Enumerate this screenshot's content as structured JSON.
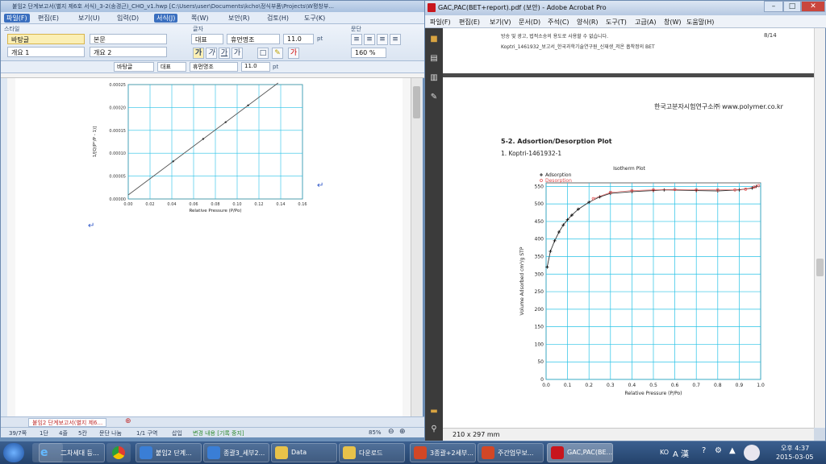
{
  "left": {
    "title": "붙임2 단계보고서(별지 제6호 서식)_3-2(송경근)_CHO_v1.hwp [C:\\Users\\user\\Documents\\kcho\\정식부품\\Projects\\W평창부...",
    "menu": [
      "파일(F)",
      "편집(E)",
      "보기(U)",
      "입력(D)",
      "서식(J)",
      "쪽(W)",
      "보안(R)",
      "검토(H)",
      "도구(K)"
    ],
    "ribbon": {
      "style_label": "스타일",
      "styles": [
        "바탕글",
        "개요 1",
        "본문",
        "개요 2"
      ],
      "font_label": "글자",
      "font_lang": "대표",
      "font_name": "휴먼명조",
      "font_size": "11.0",
      "font_unit": "pt",
      "para_label": "문단",
      "zoom_line": "160 %"
    },
    "toolbar2": {
      "style": "바탕글",
      "lang": "대표",
      "font": "휴먼명조",
      "size": "11.0",
      "unit": "pt"
    },
    "doc_tab": "붙임2 단계보고서(별지 제6...",
    "status": [
      "39/7쪽",
      "1단",
      "4줄",
      "5칸",
      "문단 나눔",
      "1/1 구역",
      "삽입",
      "변경 내용 [기록 중지]"
    ],
    "zoom": "85%",
    "graph": {
      "ylabel": "1/[Q(P°/P - 1)]",
      "xlabel": "Relative Pressure (P/Po)",
      "yticks": [
        "0.00025",
        "0.00020",
        "0.00015",
        "0.00010",
        "0.00005",
        "0.00000"
      ],
      "xticks": [
        "0.00",
        "0.02",
        "0.04",
        "0.06",
        "0.08",
        "0.10",
        "0.12",
        "0.14",
        "0.16"
      ]
    },
    "colors": {
      "grid": "#27c2e6",
      "line": "#555555"
    }
  },
  "right": {
    "title": "GAC,PAC(BET+report).pdf (보안) - Adobe Acrobat Pro",
    "menu": [
      "파일(F)",
      "편집(E)",
      "보기(V)",
      "문서(D)",
      "주석(C)",
      "양식(R)",
      "도구(T)",
      "고급(A)",
      "창(W)",
      "도움말(H)"
    ],
    "page_top_line1": "방송 및 광고, 법적소송의 용도로 사용할 수 없습니다.",
    "page_top_line2": "Koptri_1461932_보고서_한국과학기술연구원_신재생_저온 흡착정의 BET",
    "page_number": "8/14",
    "org_header": "한국고분자시험연구소㈜ www.polymer.co.kr",
    "section_title": "5-2. Adsortion/Desorption Plot",
    "sample_id": "1. Koptri-1461932-1",
    "page_size": "210 x 297 mm",
    "chart_data": {
      "type": "scatter",
      "title": "Isotherm Plot",
      "xlabel": "Relative Pressure (P/Po)",
      "ylabel": "Volume Adsorbed cm³/g STP",
      "xlim": [
        0,
        1.0
      ],
      "ylim": [
        0,
        560
      ],
      "xticks": [
        0,
        0.1,
        0.2,
        0.3,
        0.4,
        0.5,
        0.6,
        0.7,
        0.8,
        0.9,
        1.0
      ],
      "yticks": [
        0,
        50,
        100,
        150,
        200,
        250,
        300,
        350,
        400,
        450,
        500,
        550
      ],
      "grid": true,
      "legend": "top-left",
      "series": [
        {
          "name": "Adsorption",
          "marker": "+",
          "color": "#000000",
          "x": [
            0.005,
            0.02,
            0.04,
            0.06,
            0.08,
            0.1,
            0.12,
            0.15,
            0.2,
            0.25,
            0.3,
            0.4,
            0.5,
            0.55,
            0.7,
            0.8,
            0.9,
            0.96,
            0.98
          ],
          "y": [
            320,
            365,
            395,
            420,
            440,
            455,
            468,
            485,
            505,
            520,
            530,
            535,
            538,
            540,
            538,
            537,
            540,
            545,
            550
          ]
        },
        {
          "name": "Desorption",
          "marker": "o",
          "color": "#e05050",
          "x": [
            0.99,
            0.97,
            0.93,
            0.88,
            0.8,
            0.7,
            0.6,
            0.5,
            0.4,
            0.3,
            0.22
          ],
          "y": [
            552,
            548,
            542,
            540,
            540,
            540,
            541,
            540,
            538,
            533,
            515
          ]
        }
      ]
    }
  },
  "taskbar": {
    "tasks": [
      "二차세대 등...",
      "붙임2 단계...",
      "종괄3_세부2...",
      "Data",
      "다운로드",
      "3종괄+2세부...",
      "주간업무보...",
      "GAC,PAC(BE..."
    ],
    "lang": "KO",
    "ime": "A 漢",
    "time": "오후 4:37",
    "date": "2015-03-05"
  }
}
